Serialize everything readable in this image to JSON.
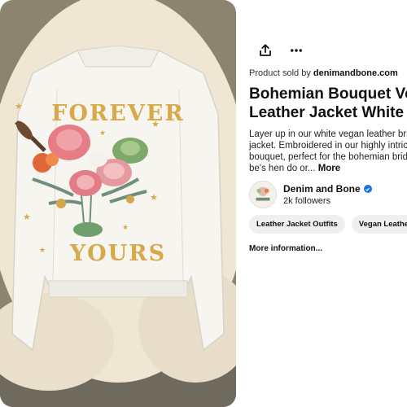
{
  "pin": {
    "image_alt": "White vegan leather jacket with embroidered floral bouquet on back",
    "embroidery_top": "FOREVER",
    "embroidery_bottom": "YOURS"
  },
  "actions": {
    "share_icon": "share-icon",
    "more_icon": "more-options-icon"
  },
  "sold_by": {
    "prefix": "Product sold by ",
    "seller": "denimandbone.com"
  },
  "title": "Bohemian Bouquet Vegan Leather Jacket White",
  "description": {
    "text": "Layer up in our white vegan leather bridal jacket. Embroidered in our highly intricate bouquet, perfect for the bohemian bride to be's hen do or...",
    "more_label": "More"
  },
  "profile": {
    "name": "Denim and Bone",
    "followers": "2k followers",
    "verified_color": "#1a73e8"
  },
  "tags": [
    {
      "label": "Leather Jacket Outfits"
    },
    {
      "label": "Vegan Leather Jacket"
    }
  ],
  "more_information": "More information..."
}
